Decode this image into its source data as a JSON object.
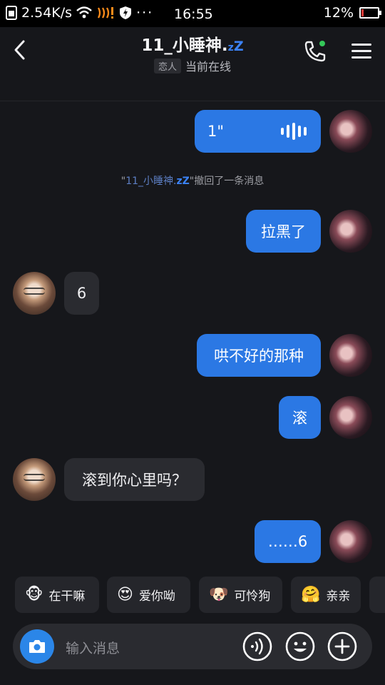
{
  "status_bar": {
    "speed": "2.54K/s",
    "time": "16:55",
    "battery_pct": "12%",
    "battery_level": 0.12
  },
  "header": {
    "title": "11_小睡神.",
    "title_zz_small": "z",
    "title_zz_big": "Z",
    "tag": "恋人",
    "status": "当前在线"
  },
  "messages": {
    "voice_duration": "1\"",
    "recall_prefix": "\"",
    "recall_name": "11_小睡神.",
    "recall_zz": "zZ",
    "recall_suffix": "\"撤回了一条消息",
    "m1": "拉黑了",
    "m2": "6",
    "m3": "哄不好的那种",
    "m4": "滚",
    "m5": "滚到你心里吗？",
    "m6": "……6"
  },
  "quick_replies": [
    {
      "emoji": "🐵",
      "label": "在干嘛"
    },
    {
      "emoji": "😍",
      "label": "爱你呦"
    },
    {
      "emoji": "🐶",
      "label": "可怜狗"
    },
    {
      "emoji": "🤗",
      "label": "亲亲"
    }
  ],
  "input": {
    "placeholder": "输入消息"
  },
  "colors": {
    "accent": "#2b78e4",
    "background": "#16171b",
    "online_dot": "#34c759"
  }
}
